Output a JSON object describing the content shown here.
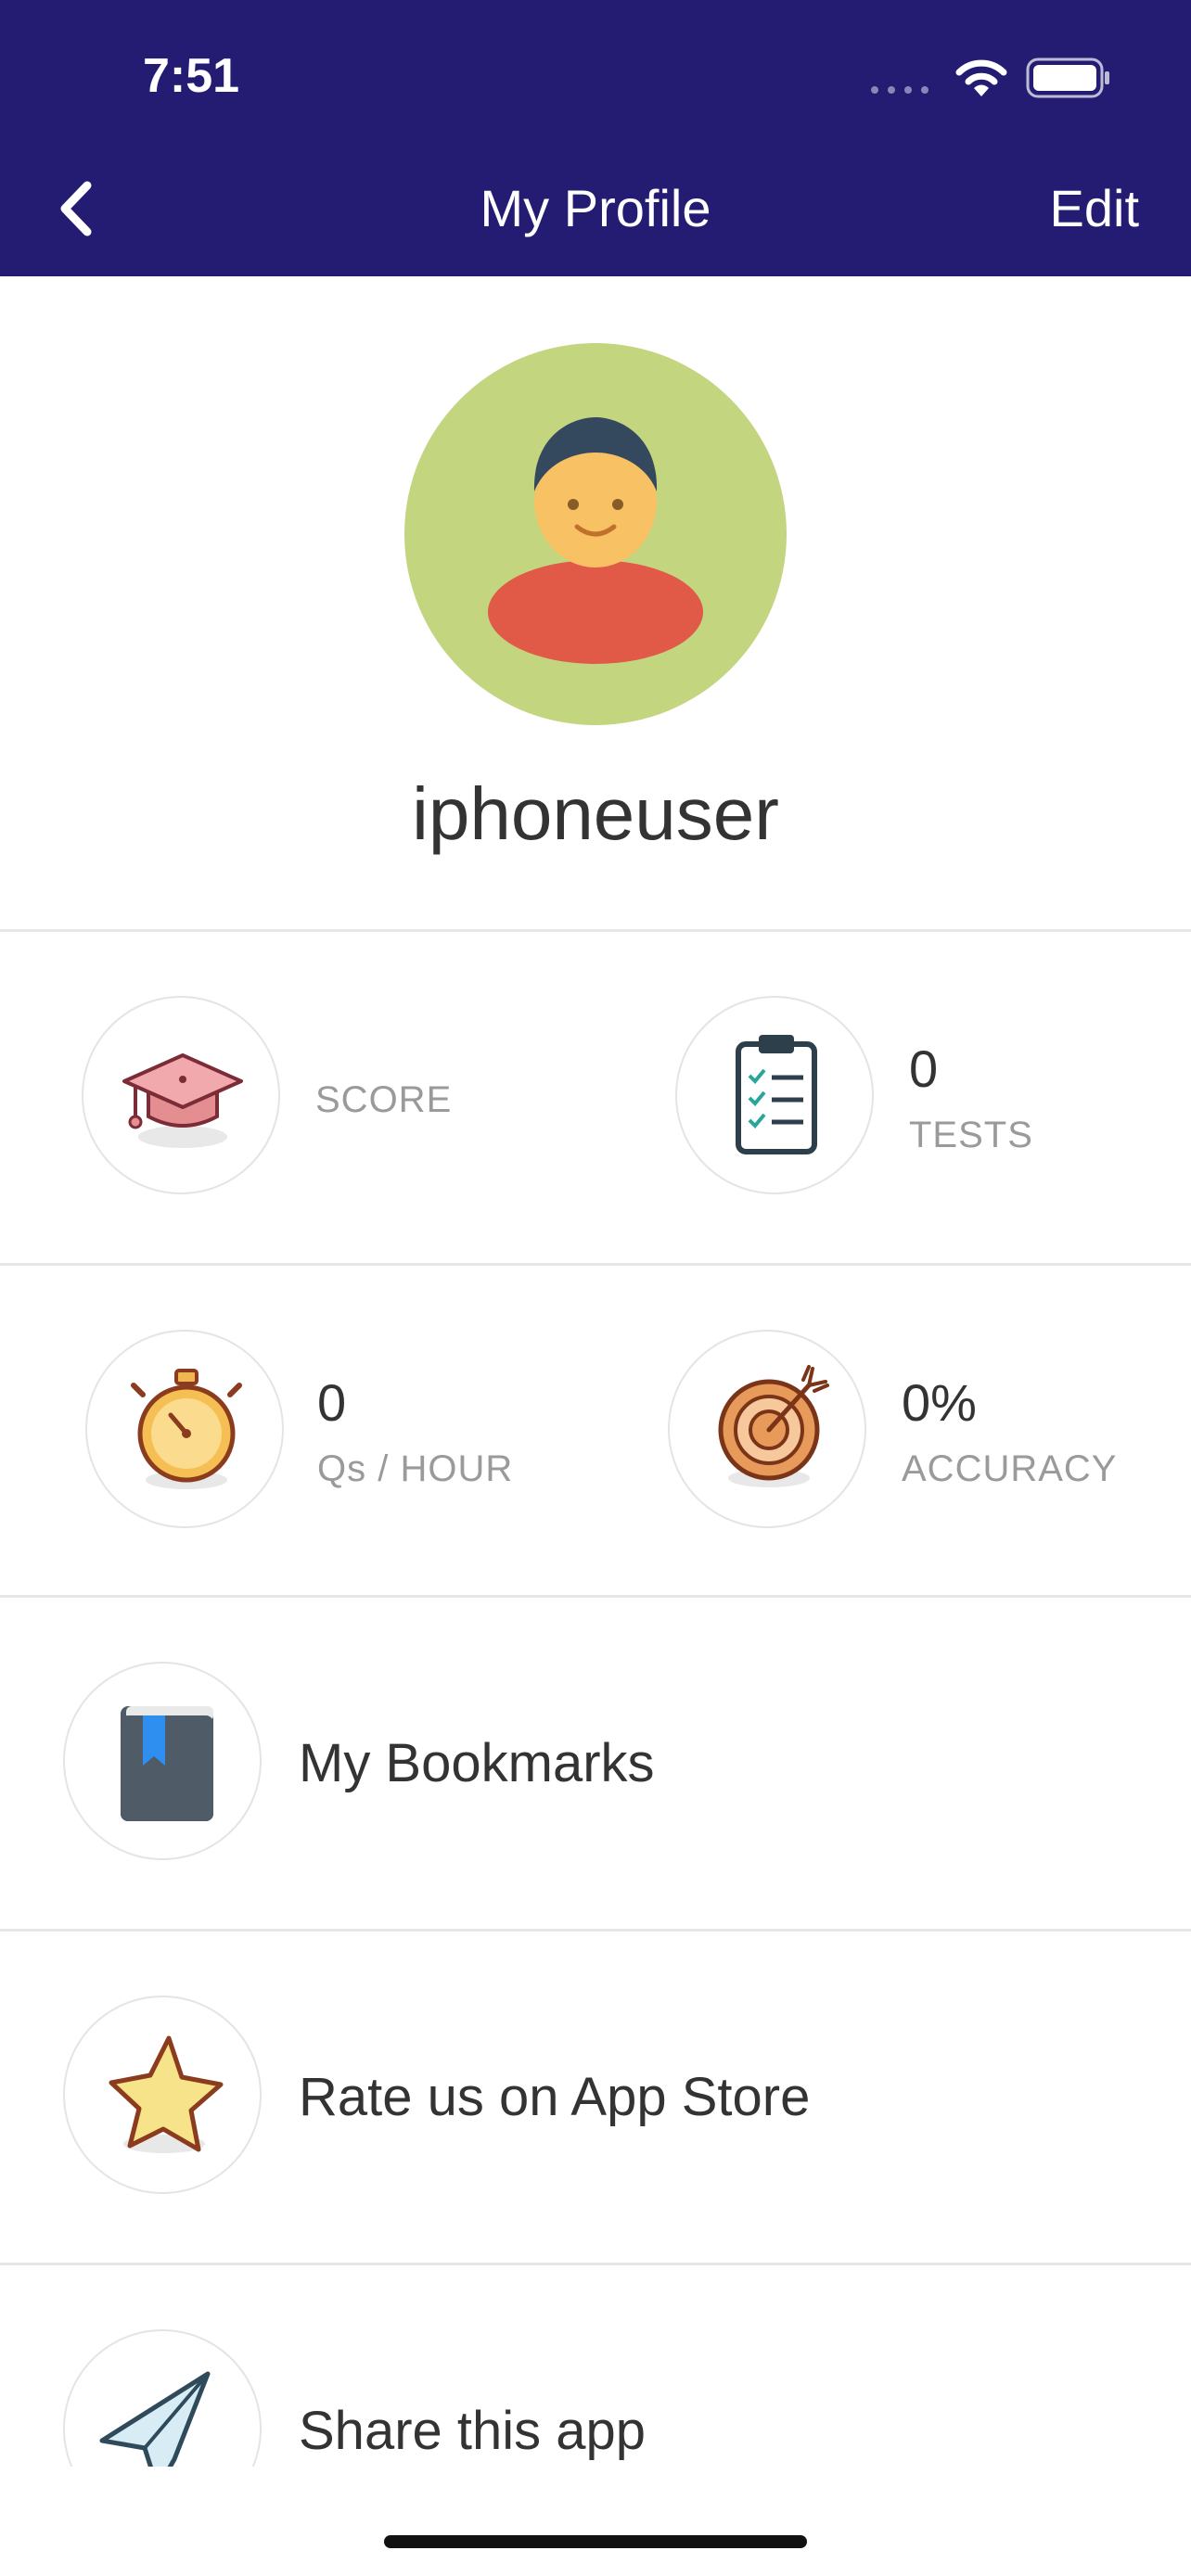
{
  "status_bar": {
    "time": "7:51"
  },
  "nav": {
    "title": "My Profile",
    "edit_label": "Edit",
    "back_icon": "chevron-left-icon"
  },
  "profile": {
    "username": "iphoneuser",
    "avatar_icon": "user-avatar-icon"
  },
  "stats": {
    "score": {
      "label": "SCORE",
      "icon": "graduation-cap-icon"
    },
    "tests": {
      "value": "0",
      "label": "TESTS",
      "icon": "clipboard-checklist-icon"
    },
    "qs_per_hour": {
      "value": "0",
      "label": "Qs / HOUR",
      "icon": "stopwatch-icon"
    },
    "accuracy": {
      "value": "0%",
      "label": "ACCURACY",
      "icon": "target-icon"
    }
  },
  "menu": [
    {
      "label": "My Bookmarks",
      "icon": "bookmark-book-icon"
    },
    {
      "label": "Rate us on App Store",
      "icon": "star-icon"
    },
    {
      "label": "Share this app",
      "icon": "paper-plane-icon"
    }
  ],
  "colors": {
    "header": "#231c72",
    "avatar_bg": "#c3d57f",
    "avatar_shirt": "#e05a47",
    "avatar_face": "#f8c264",
    "avatar_hair": "#34495e"
  }
}
